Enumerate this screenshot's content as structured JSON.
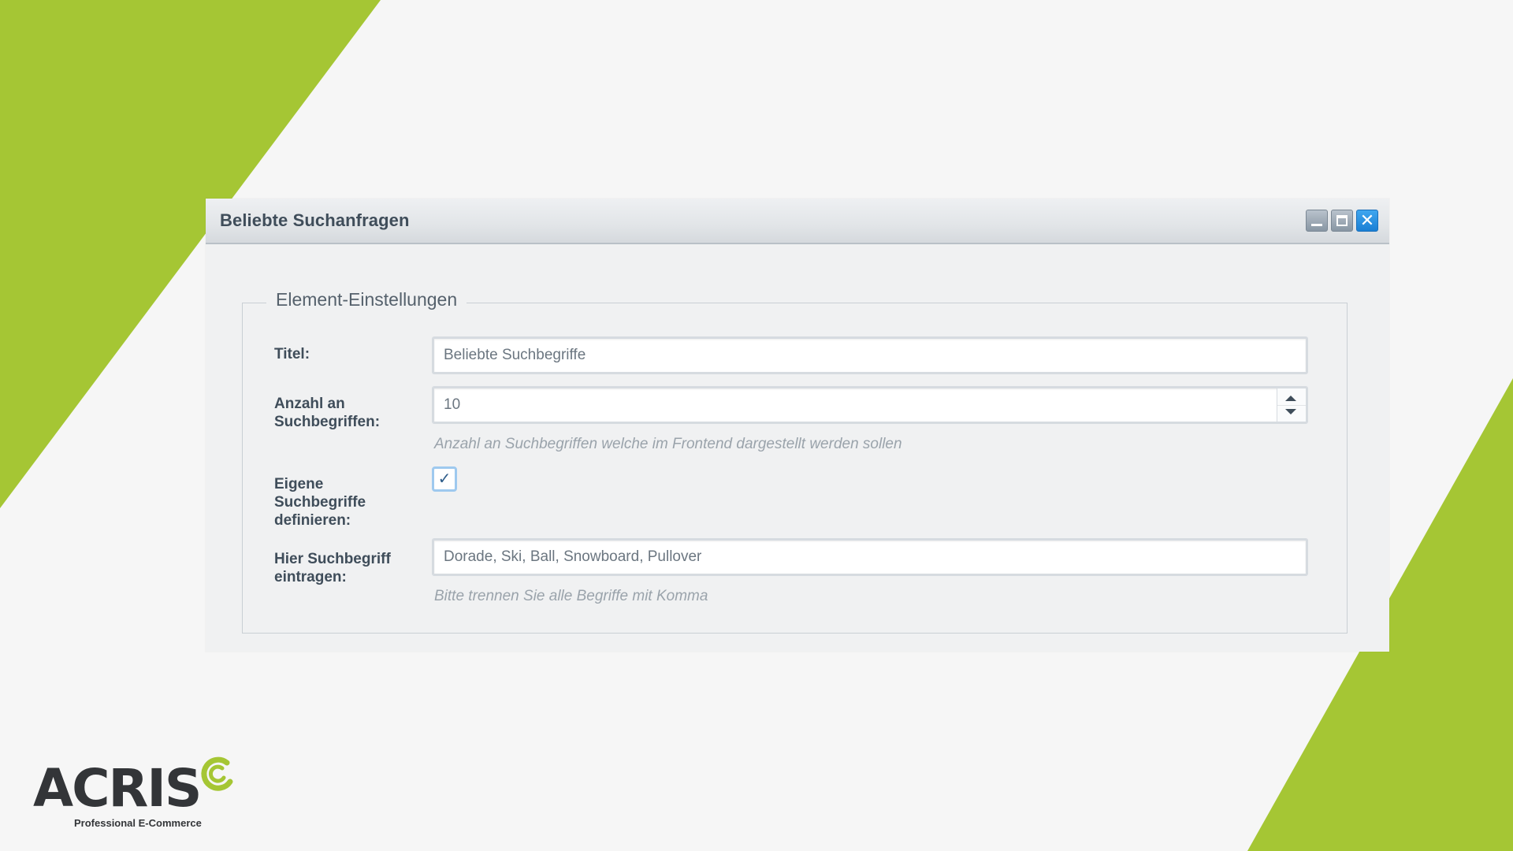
{
  "colors": {
    "accent_green": "#a5c634",
    "background": "#f6f6f6",
    "close_button": "#1f87dd"
  },
  "window": {
    "title": "Beliebte Suchanfragen",
    "buttons": {
      "minimize_icon": "minimize-icon",
      "maximize_icon": "maximize-icon",
      "close_icon": "close-icon",
      "close_glyph": "✕"
    }
  },
  "fieldset": {
    "legend": "Element-Einstellungen",
    "fields": {
      "title": {
        "label": "Titel:",
        "value": "Beliebte Suchbegriffe"
      },
      "count": {
        "label": "Anzahl an Suchbegriffen:",
        "value": "10",
        "help": "Anzahl an Suchbegriffen welche im Frontend dargestellt werden sollen"
      },
      "custom": {
        "label": "Eigene Suchbegriffe definieren:",
        "checked": true,
        "check_glyph": "✓"
      },
      "terms": {
        "label": "Hier Suchbegriff eintragen:",
        "value": "Dorade, Ski, Ball, Snowboard, Pullover",
        "help": "Bitte trennen Sie alle Begriffe mit Komma"
      }
    }
  },
  "logo": {
    "name": "ACRIS",
    "tagline": "Professional E-Commerce"
  }
}
